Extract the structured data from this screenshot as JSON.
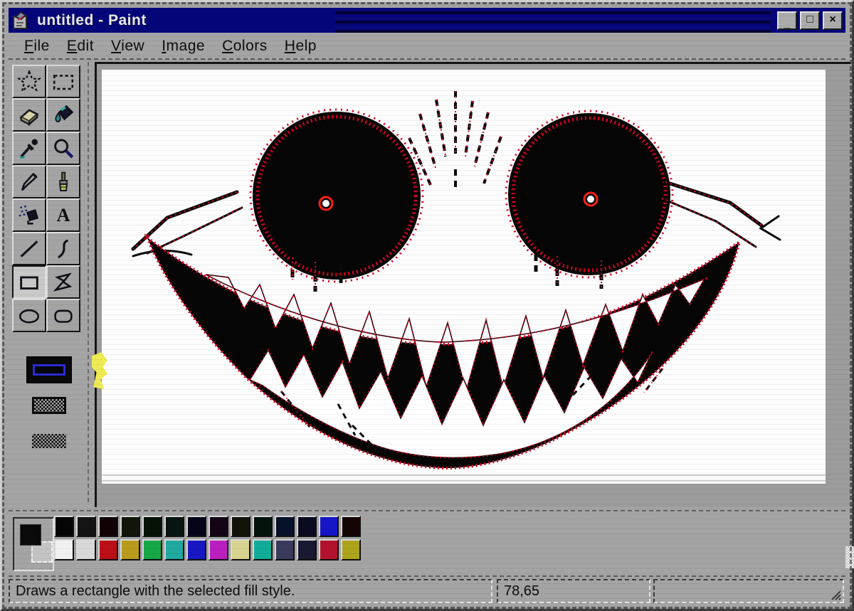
{
  "window": {
    "title": "untitled - Paint",
    "controls": {
      "minimize": "_",
      "maximize": "□",
      "close": "×"
    }
  },
  "menu": {
    "items": [
      {
        "label": "File"
      },
      {
        "label": "Edit"
      },
      {
        "label": "View"
      },
      {
        "label": "Image"
      },
      {
        "label": "Colors"
      },
      {
        "label": "Help"
      }
    ]
  },
  "toolbox": {
    "tools": [
      {
        "name": "free-form-select"
      },
      {
        "name": "select"
      },
      {
        "name": "eraser"
      },
      {
        "name": "fill-with-color"
      },
      {
        "name": "pick-color"
      },
      {
        "name": "magnifier"
      },
      {
        "name": "pencil"
      },
      {
        "name": "brush"
      },
      {
        "name": "airbrush"
      },
      {
        "name": "text",
        "glyph": "A"
      },
      {
        "name": "line"
      },
      {
        "name": "curve"
      },
      {
        "name": "rectangle",
        "selected": true
      },
      {
        "name": "polygon"
      },
      {
        "name": "ellipse"
      },
      {
        "name": "rounded-rectangle"
      }
    ],
    "fill_styles": [
      {
        "name": "outline-only",
        "selected": true
      },
      {
        "name": "outline-with-fill",
        "selected": false
      },
      {
        "name": "fill-only",
        "selected": false
      }
    ]
  },
  "canvas": {
    "description": "glitched creepy smiling face: two black halftone eyes with glowing pupils and a huge jagged-toothed grin",
    "ink_color": "#0a0a0a",
    "halftone_color": "#e00020",
    "background_color": "#fdfdfd"
  },
  "palette": {
    "foreground": "#0a0a0a",
    "background": "#c4c4c4",
    "top_row": [
      "#050505",
      "#141414",
      "#120004",
      "#11160a",
      "#061206",
      "#07140f",
      "#05051a",
      "#140414",
      "#12140a",
      "#04140c",
      "#06122a",
      "#0a0a20",
      "#1616c8",
      "#160404"
    ],
    "bottom_row": [
      "#f2f2f2",
      "#d9d9d9",
      "#bd0f16",
      "#b99b1c",
      "#17a848",
      "#1fa9a0",
      "#1717c3",
      "#bb1fc0",
      "#d8d48e",
      "#12ad98",
      "#3a3a5c",
      "#191933",
      "#b3122e",
      "#ada41c"
    ]
  },
  "status_bar": {
    "message": "Draws a rectangle with the selected fill style.",
    "coordinates": "78,65"
  }
}
